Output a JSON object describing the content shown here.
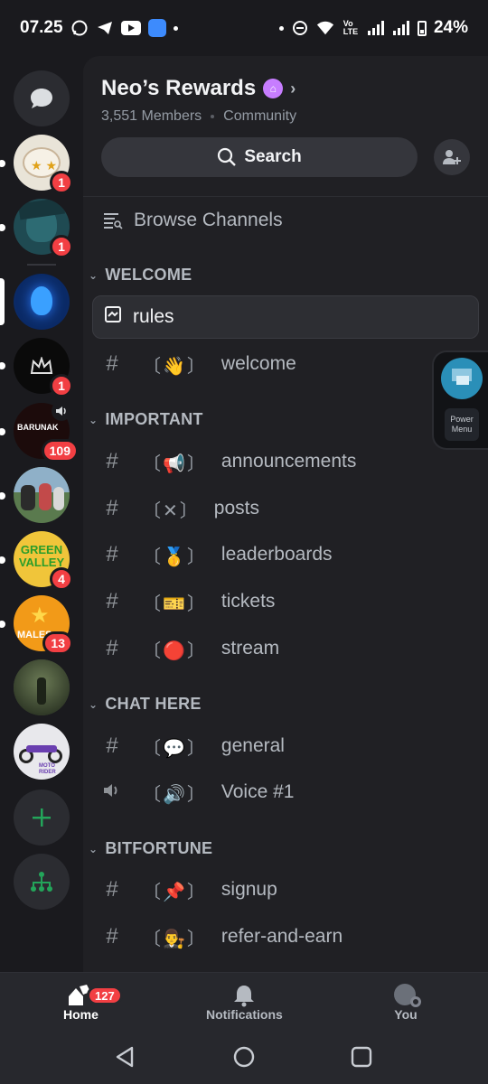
{
  "status_bar": {
    "time": "07.25",
    "battery": "24%"
  },
  "server_rail": {
    "servers": [
      {
        "name": "server-1",
        "badge": "1",
        "color": "#e9e4d8",
        "unread": true
      },
      {
        "name": "server-2",
        "badge": "1",
        "color": "#1f4a52",
        "unread": true
      },
      {
        "name": "server-3",
        "badge": "",
        "color": "#0b2a66",
        "selected": true
      },
      {
        "name": "server-4",
        "badge": "1",
        "color": "#0a0a0a",
        "unread": true
      },
      {
        "name": "server-5",
        "badge": "109",
        "color": "#1c0b0b",
        "unread": true,
        "avatar_text": "BARUNAK"
      },
      {
        "name": "server-6",
        "badge": "",
        "color": "#5a7a4e",
        "unread": true
      },
      {
        "name": "server-7",
        "badge": "4",
        "color": "#f0c53a",
        "unread": true,
        "avatar_text": "GREEN VALLEY"
      },
      {
        "name": "server-8",
        "badge": "13",
        "color": "#f29a18",
        "unread": true,
        "avatar_text": "MALES"
      },
      {
        "name": "server-9",
        "badge": "",
        "color": "#3f4a32",
        "unread": false
      },
      {
        "name": "server-10",
        "badge": "",
        "color": "#e8e8ec",
        "unread": false,
        "avatar_text": "MOTO RIDER"
      }
    ]
  },
  "guild": {
    "name": "Neo’s Rewards",
    "members": "3,551 Members",
    "type": "Community",
    "search_label": "Search"
  },
  "channels": {
    "browse_label": "Browse Channels",
    "categories": [
      {
        "name": "WELCOME"
      },
      {
        "name": "IMPORTANT"
      },
      {
        "name": "CHAT HERE"
      },
      {
        "name": "BITFORTUNE"
      }
    ],
    "items": [
      {
        "label": "rules",
        "emoji": ""
      },
      {
        "label": "welcome",
        "emoji": "〔👋〕"
      },
      {
        "label": "announcements",
        "emoji": "〔📢〕"
      },
      {
        "label": "posts",
        "emoji": "〔✕〕"
      },
      {
        "label": "leaderboards",
        "emoji": "〔🥇〕"
      },
      {
        "label": "tickets",
        "emoji": "〔🎫〕"
      },
      {
        "label": "stream",
        "emoji": "〔🔴〕"
      },
      {
        "label": "general",
        "emoji": "〔💬〕"
      },
      {
        "label": "Voice #1",
        "emoji": "〔🔊〕"
      },
      {
        "label": "signup",
        "emoji": "〔📌〕"
      },
      {
        "label": "refer-and-earn",
        "emoji": "〔👨‍⚖️〕"
      }
    ]
  },
  "power_menu": {
    "label": "Power Menu"
  },
  "bottom_nav": {
    "home": "Home",
    "home_badge": "127",
    "notifications": "Notifications",
    "you": "You"
  },
  "colors": {
    "accent_green": "#23a55a",
    "badge_red": "#f23f43",
    "panel": "#202024",
    "rail": "#1a1a1e"
  }
}
